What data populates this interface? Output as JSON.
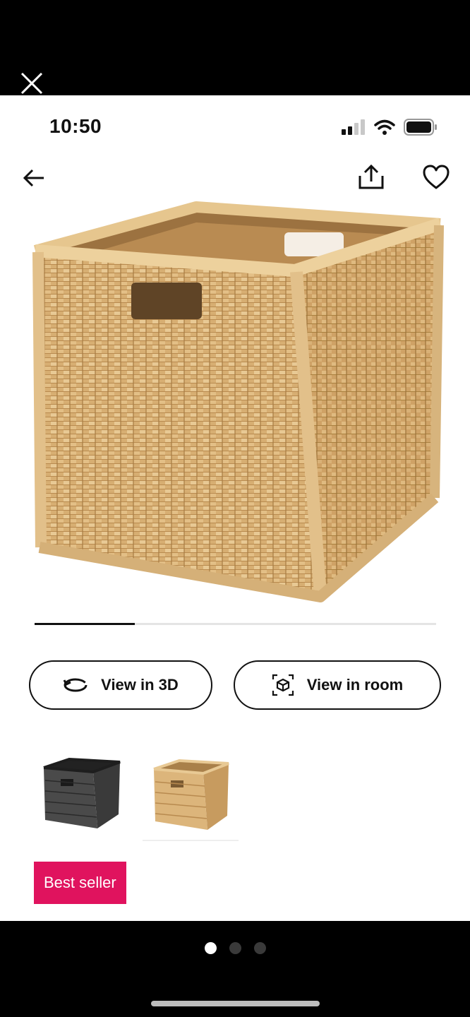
{
  "status_bar": {
    "time": "10:50"
  },
  "actions": {
    "view_3d_label": "View in 3D",
    "view_room_label": "View in room"
  },
  "gallery": {
    "image_index": 1,
    "image_count": 4,
    "progress_fraction": 0.25
  },
  "color_options": [
    {
      "color": "dark grey",
      "hex": "#3c3c3c"
    },
    {
      "color": "natural rattan",
      "hex": "#c99b5c",
      "selected": true
    }
  ],
  "badge": {
    "label": "Best seller",
    "color": "#e0135e"
  },
  "pager": {
    "pages": 3,
    "active": 1
  }
}
